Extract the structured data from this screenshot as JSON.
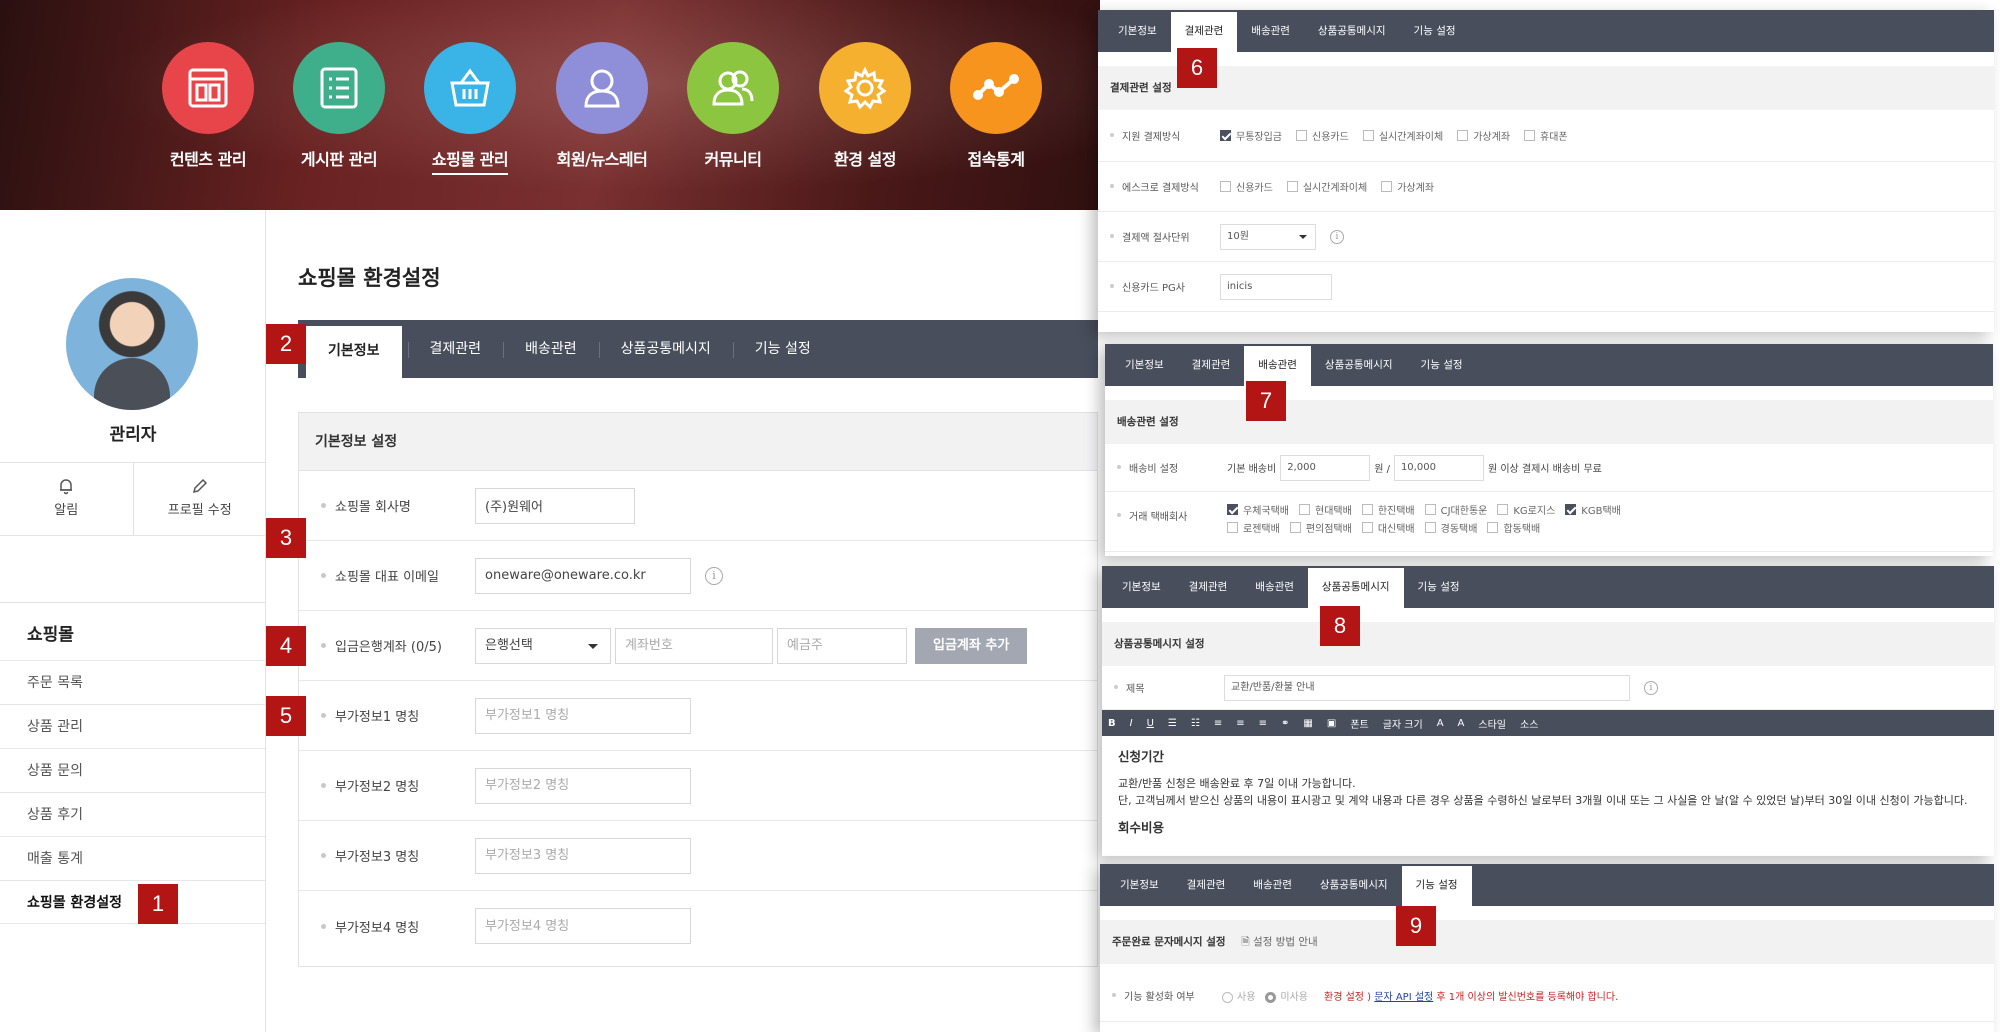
{
  "nav": [
    {
      "label": "컨텐츠 관리",
      "color": "#e8454a"
    },
    {
      "label": "게시판 관리",
      "color": "#3fae8a"
    },
    {
      "label": "쇼핑몰 관리",
      "color": "#3ab3e6"
    },
    {
      "label": "회원/뉴스레터",
      "color": "#8e8fd8"
    },
    {
      "label": "커뮤니티",
      "color": "#8cc540"
    },
    {
      "label": "환경 설정",
      "color": "#f5b030"
    },
    {
      "label": "접속통계",
      "color": "#f7941d"
    }
  ],
  "profile": {
    "name": "관리자",
    "alarm": "알림",
    "edit": "프로필 수정"
  },
  "sidebar": {
    "title": "쇼핑몰",
    "items": [
      {
        "label": "주문 목록"
      },
      {
        "label": "상품 관리"
      },
      {
        "label": "상품 문의"
      },
      {
        "label": "상품 후기"
      },
      {
        "label": "매출 통계"
      },
      {
        "label": "쇼핑몰 환경설정"
      }
    ]
  },
  "main": {
    "title": "쇼핑몰 환경설정",
    "tabs": [
      "기본정보",
      "결제관련",
      "배송관련",
      "상품공통메시지",
      "기능 설정"
    ],
    "panel_title": "기본정보 설정",
    "company_label": "쇼핑몰 회사명",
    "company_value": "(주)원웨어",
    "email_label": "쇼핑몰 대표 이메일",
    "email_value": "oneware@oneware.co.kr",
    "bank_label": "입금은행계좌 (0/5)",
    "bank_select": "은행선택",
    "account_placeholder": "계좌번호",
    "holder_placeholder": "예금주",
    "add_account": "입금계좌 추가",
    "extra": [
      {
        "label": "부가정보1 명칭",
        "placeholder": "부가정보1 명칭"
      },
      {
        "label": "부가정보2 명칭",
        "placeholder": "부가정보2 명칭"
      },
      {
        "label": "부가정보3 명칭",
        "placeholder": "부가정보3 명칭"
      },
      {
        "label": "부가정보4 명칭",
        "placeholder": "부가정보4 명칭"
      }
    ],
    "info_glyph": "i"
  },
  "badges": [
    "1",
    "2",
    "3",
    "4",
    "5",
    "6",
    "7",
    "8",
    "9"
  ],
  "payment": {
    "heading": "결제관련 설정",
    "methods_label": "지원 결제방식",
    "methods": [
      {
        "label": "무통장입금",
        "checked": true
      },
      {
        "label": "신용카드",
        "checked": false
      },
      {
        "label": "실시간계좌이체",
        "checked": false
      },
      {
        "label": "가상계좌",
        "checked": false
      },
      {
        "label": "휴대폰",
        "checked": false
      }
    ],
    "escrow_label": "에스크로 결제방식",
    "escrow": [
      {
        "label": "신용카드",
        "checked": false
      },
      {
        "label": "실시간계좌이체",
        "checked": false
      },
      {
        "label": "가상계좌",
        "checked": false
      }
    ],
    "rounding_label": "결제액 절사단위",
    "rounding_value": "10원",
    "pg_label": "신용카드 PG사",
    "pg_value": "inicis"
  },
  "shipping": {
    "heading": "배송관련 설정",
    "fee_label": "배송비 설정",
    "base_label": "기본 배송비",
    "base_value": "2,000",
    "won_slash": "원 /",
    "free_value": "10,000",
    "free_suffix": "원 이상 결제시 배송비 무료",
    "couriers_label": "거래 택배회사",
    "couriers": [
      {
        "label": "우체국택배",
        "checked": true
      },
      {
        "label": "현대택배",
        "checked": false
      },
      {
        "label": "한진택배",
        "checked": false
      },
      {
        "label": "CJ대한통운",
        "checked": false
      },
      {
        "label": "KG로지스",
        "checked": false
      },
      {
        "label": "KGB택배",
        "checked": true
      },
      {
        "label": "로젠택배",
        "checked": false
      },
      {
        "label": "편의점택배",
        "checked": false
      },
      {
        "label": "대신택배",
        "checked": false
      },
      {
        "label": "경동택배",
        "checked": false
      },
      {
        "label": "합동택배",
        "checked": false
      }
    ]
  },
  "common_msg": {
    "heading": "상품공통메시지 설정",
    "subject_label": "제목",
    "subject_value": "교환/반품/환불 안내",
    "toolbar": [
      "B",
      "I",
      "U",
      "폰트",
      "글자 크기",
      "A",
      "A",
      "스타일",
      "소스"
    ],
    "body_title": "신청기간",
    "body_line1": "교환/반품 신청은 배송완료 후 7일 이내 가능합니다.",
    "body_line2": "단, 고객님께서 받으신 상품의 내용이 표시광고 및 계약 내용과 다른 경우 상품을 수령하신 날로부터 3개월 이내 또는 그 사실을 안 날(알 수 있었던 날)부터 30일 이내 신청이 가능합니다.",
    "body_next": "회수비용"
  },
  "feature": {
    "heading": "주문완료 문자메시지 설정",
    "guide_link": "설정 방법 안내",
    "activate_label": "기능 활성화 여부",
    "use": "사용",
    "not_use": "미사용",
    "notice_1": "환경 설정 ) ",
    "notice_link": "문자 API 설정",
    "notice_2": " 후 1개 이상의 발신번호를 등록해야 합니다."
  }
}
